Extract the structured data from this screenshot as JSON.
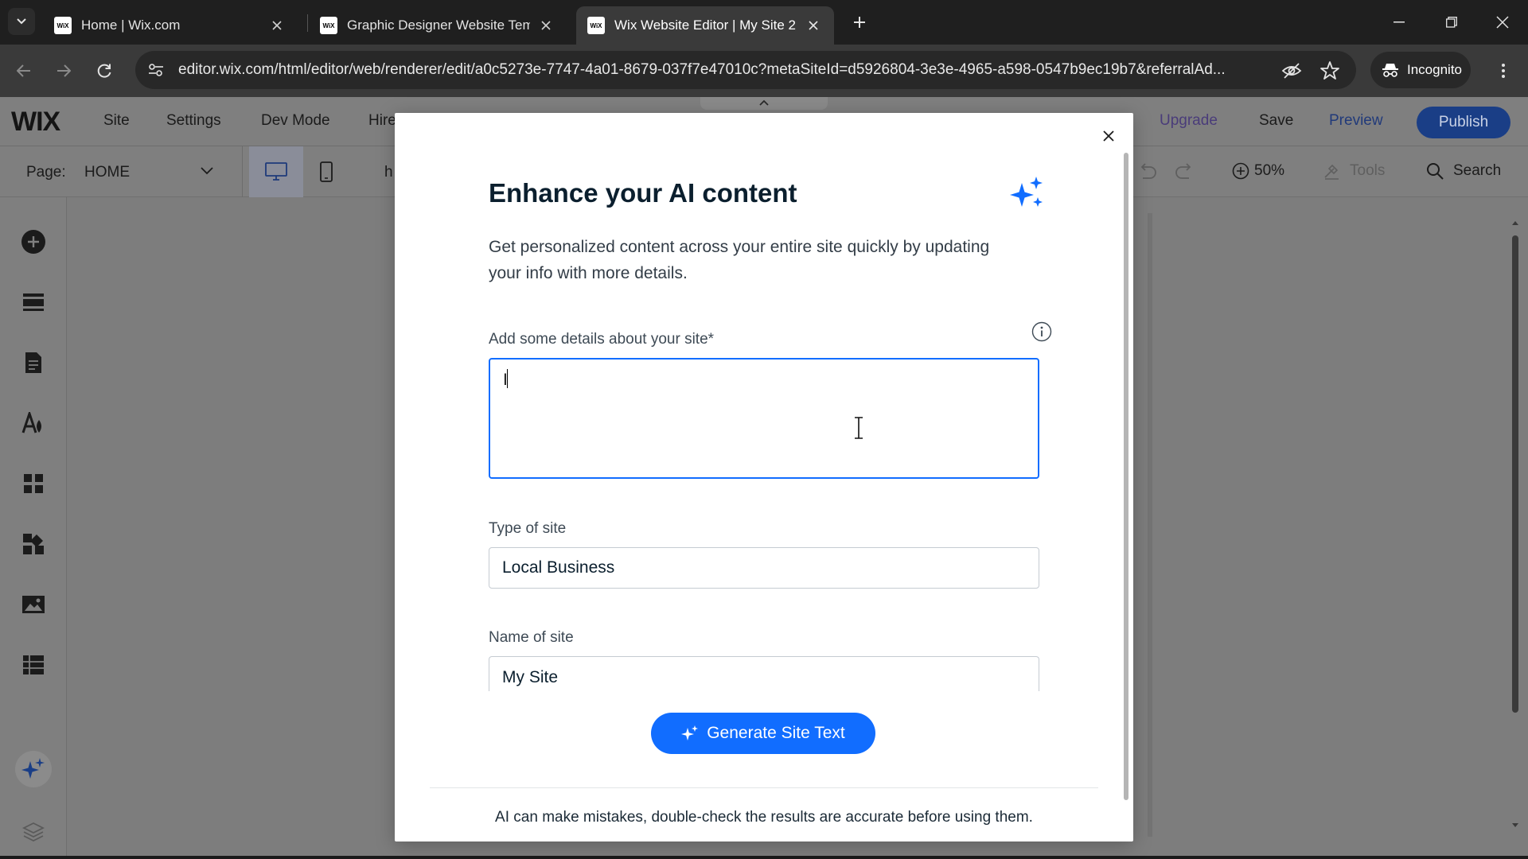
{
  "browser": {
    "tabs": [
      {
        "title": "Home | Wix.com",
        "favicon": "wix-favicon",
        "active": false
      },
      {
        "title": "Graphic Designer Website Temp",
        "favicon": "wix-favicon",
        "active": false
      },
      {
        "title": "Wix Website Editor | My Site 2",
        "favicon": "wix-favicon",
        "active": true
      }
    ],
    "favicon_text": "WiX",
    "url": "editor.wix.com/html/editor/web/renderer/edit/a0c5273e-7747-4a01-8679-037f7e47010c?metaSiteId=d5926804-3e3e-4965-a598-0547b9ec19b7&referralAd...",
    "incognito_label": "Incognito",
    "icons": [
      "tab-search-icon",
      "close-icon",
      "new-tab-icon",
      "minimize-icon",
      "restore-icon",
      "window-close-icon",
      "back-icon",
      "forward-icon",
      "reload-icon",
      "site-info-icon",
      "eye-off-icon",
      "star-icon",
      "incognito-icon",
      "more-vert-icon"
    ]
  },
  "wix_editor": {
    "logo": "WIX",
    "menu": [
      "Site",
      "Settings",
      "Dev Mode",
      "Hire"
    ],
    "upgrade": "Upgrade",
    "save": "Save",
    "preview": "Preview",
    "publish": "Publish",
    "page_label": "Page:",
    "page_value": "HOME",
    "truncated_text": "h",
    "zoom": "50%",
    "tools": "Tools",
    "search": "Search",
    "rail_icons": [
      "add-icon",
      "sections-icon",
      "pages-icon",
      "design-icon",
      "apps-icon",
      "business-apps-icon",
      "media-icon",
      "cms-icon",
      "ai-sparkle-icon",
      "layers-icon"
    ],
    "colors": {
      "publish": "#116dff",
      "overlay": "#7f7f7f"
    }
  },
  "modal": {
    "title": "Enhance your AI content",
    "description": "Get personalized content across your entire site quickly by updating your info with more details.",
    "details_label": "Add some details about your site*",
    "details_value": "I",
    "type_label": "Type of site",
    "type_value": "Local Business",
    "name_label": "Name of site",
    "name_value": "My Site",
    "generate_button": "Generate Site Text",
    "disclaimer": "AI can make mistakes, double-check the results are accurate before using them.",
    "icons": [
      "close-icon",
      "sparkle-icon",
      "info-icon",
      "text-cursor-icon"
    ],
    "colors": {
      "accent": "#116dff",
      "title": "#0b1f2e"
    }
  }
}
